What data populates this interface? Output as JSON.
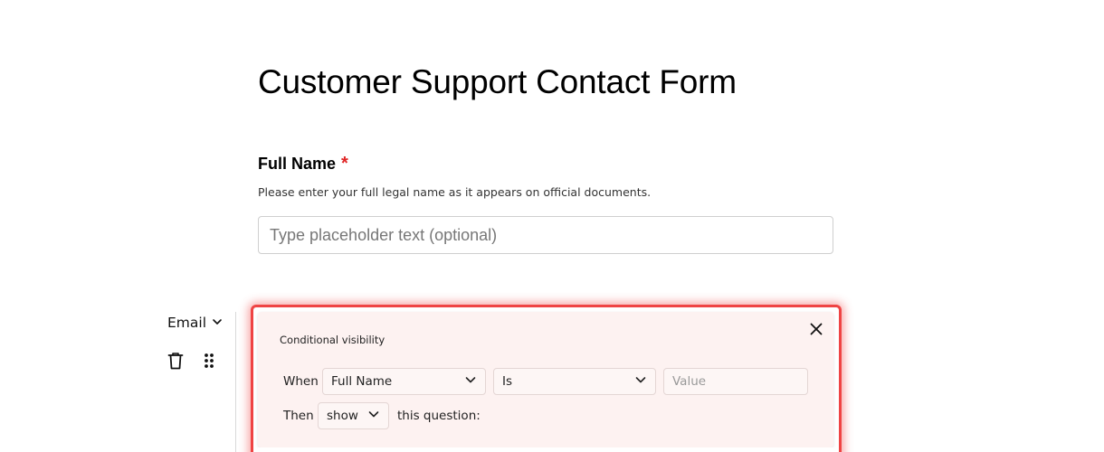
{
  "form": {
    "title": "Customer Support Contact Form"
  },
  "field": {
    "label": "Full Name",
    "required_mark": "*",
    "description": "Please enter your full legal name as it appears on official documents.",
    "placeholder": "Type placeholder text (optional)",
    "value": ""
  },
  "sidebar": {
    "type_label": "Email",
    "type_icon": "chevron-down-icon",
    "delete_icon": "trash-icon",
    "drag_icon": "drag-handle-icon"
  },
  "conditional": {
    "title": "Conditional visibility",
    "close_icon": "close-icon",
    "when_label": "When",
    "field_selected": "Full Name",
    "operator_selected": "Is",
    "value_placeholder": "Value",
    "value": "",
    "then_label": "Then",
    "action_selected": "show",
    "tail_text": "this question:",
    "accent_color": "#ef4444",
    "panel_bg": "#fdf2f1"
  }
}
